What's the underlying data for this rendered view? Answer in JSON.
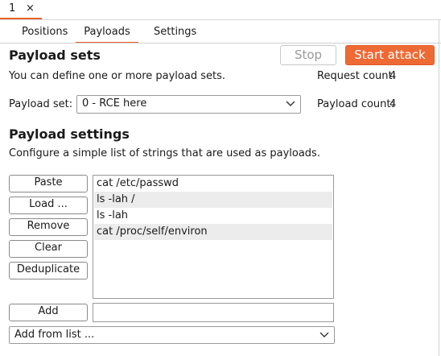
{
  "window": {
    "tab_number": "1",
    "tab_close": "×"
  },
  "subtabs": [
    {
      "label": "Positions",
      "active": false
    },
    {
      "label": "Payloads",
      "active": true
    },
    {
      "label": "Settings",
      "active": false
    }
  ],
  "payload_sets": {
    "heading": "Payload sets",
    "description": "You can define one or more payload sets.",
    "stop_label": "Stop",
    "start_label": "Start attack",
    "request_count_label": "Request count:",
    "request_count": "4",
    "payload_set_label": "Payload set:",
    "payload_set_value": "0 - RCE here",
    "payload_count_label": "Payload count:",
    "payload_count": "4"
  },
  "payload_settings": {
    "heading": "Payload settings",
    "description": "Configure a simple list of strings that are used as payloads.",
    "buttons": {
      "paste": "Paste",
      "load": "Load ...",
      "remove": "Remove",
      "clear": "Clear",
      "deduplicate": "Deduplicate",
      "add": "Add"
    },
    "items": [
      "cat /etc/passwd",
      "ls -lah /",
      "ls -lah",
      "cat /proc/self/environ"
    ],
    "add_input_value": "",
    "add_from_list_label": "Add from list ..."
  },
  "colors": {
    "accent": "#e8612c",
    "start_button": "#ee6a35",
    "row_alt": "#ececec"
  }
}
